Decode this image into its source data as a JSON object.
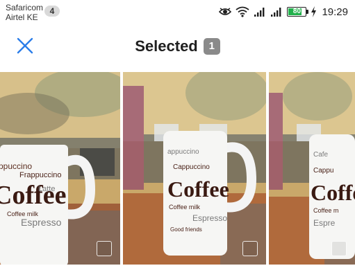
{
  "status_bar": {
    "carriers": [
      "Safaricom",
      "Airtel KE"
    ],
    "notification_count": "4",
    "battery_level": "80",
    "time": "19:29",
    "icons": [
      "eye-icon",
      "wifi-icon",
      "signal-icon",
      "signal-icon",
      "battery-icon",
      "charging-icon"
    ]
  },
  "header": {
    "close_icon": "close-icon",
    "title": "Selected",
    "count": "1",
    "accent_color": "#2b7de9"
  },
  "photos": {
    "items": [
      {
        "label": "photo-1",
        "selected": false
      },
      {
        "label": "photo-2",
        "selected": false
      },
      {
        "label": "photo-3",
        "selected": false
      }
    ],
    "mug_text": {
      "brand": "Coffee",
      "words": [
        "Cappuccino",
        "Frappuccino",
        "Latte",
        "Espresso",
        "Coffee milk",
        "Cafe",
        "Good friends"
      ]
    }
  }
}
